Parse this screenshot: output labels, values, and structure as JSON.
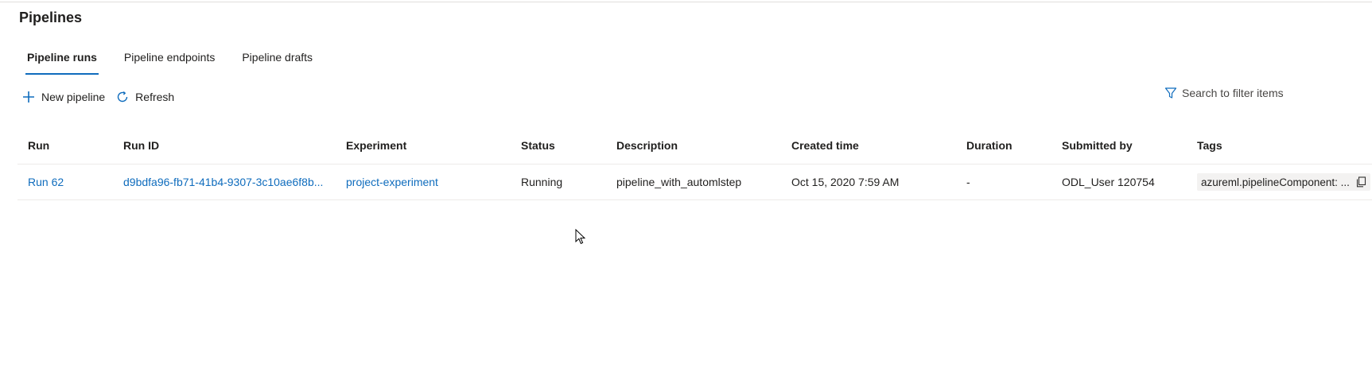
{
  "page": {
    "title": "Pipelines"
  },
  "tabs": [
    {
      "label": "Pipeline runs",
      "active": true
    },
    {
      "label": "Pipeline endpoints",
      "active": false
    },
    {
      "label": "Pipeline drafts",
      "active": false
    }
  ],
  "toolbar": {
    "new_pipeline_label": "New pipeline",
    "new_pipeline_icon": "plus-icon",
    "refresh_label": "Refresh",
    "refresh_icon": "refresh-icon"
  },
  "search": {
    "label": "Search to filter items",
    "icon": "filter-icon"
  },
  "table": {
    "columns": [
      "Run",
      "Run ID",
      "Experiment",
      "Status",
      "Description",
      "Created time",
      "Duration",
      "Submitted by",
      "Tags"
    ],
    "rows": [
      {
        "run": "Run 62",
        "run_id": "d9bdfa96-fb71-41b4-9307-3c10ae6f8b...",
        "experiment": "project-experiment",
        "status": "Running",
        "description": "pipeline_with_automlstep",
        "created_time": "Oct 15, 2020 7:59 AM",
        "duration": "-",
        "submitted_by": "ODL_User 120754",
        "tag": "azureml.pipelineComponent: ...",
        "tag_icon": "copy-icon"
      }
    ]
  },
  "colors": {
    "accent": "#0f6cbd",
    "text": "#201f1e",
    "divider": "#edebe9"
  }
}
